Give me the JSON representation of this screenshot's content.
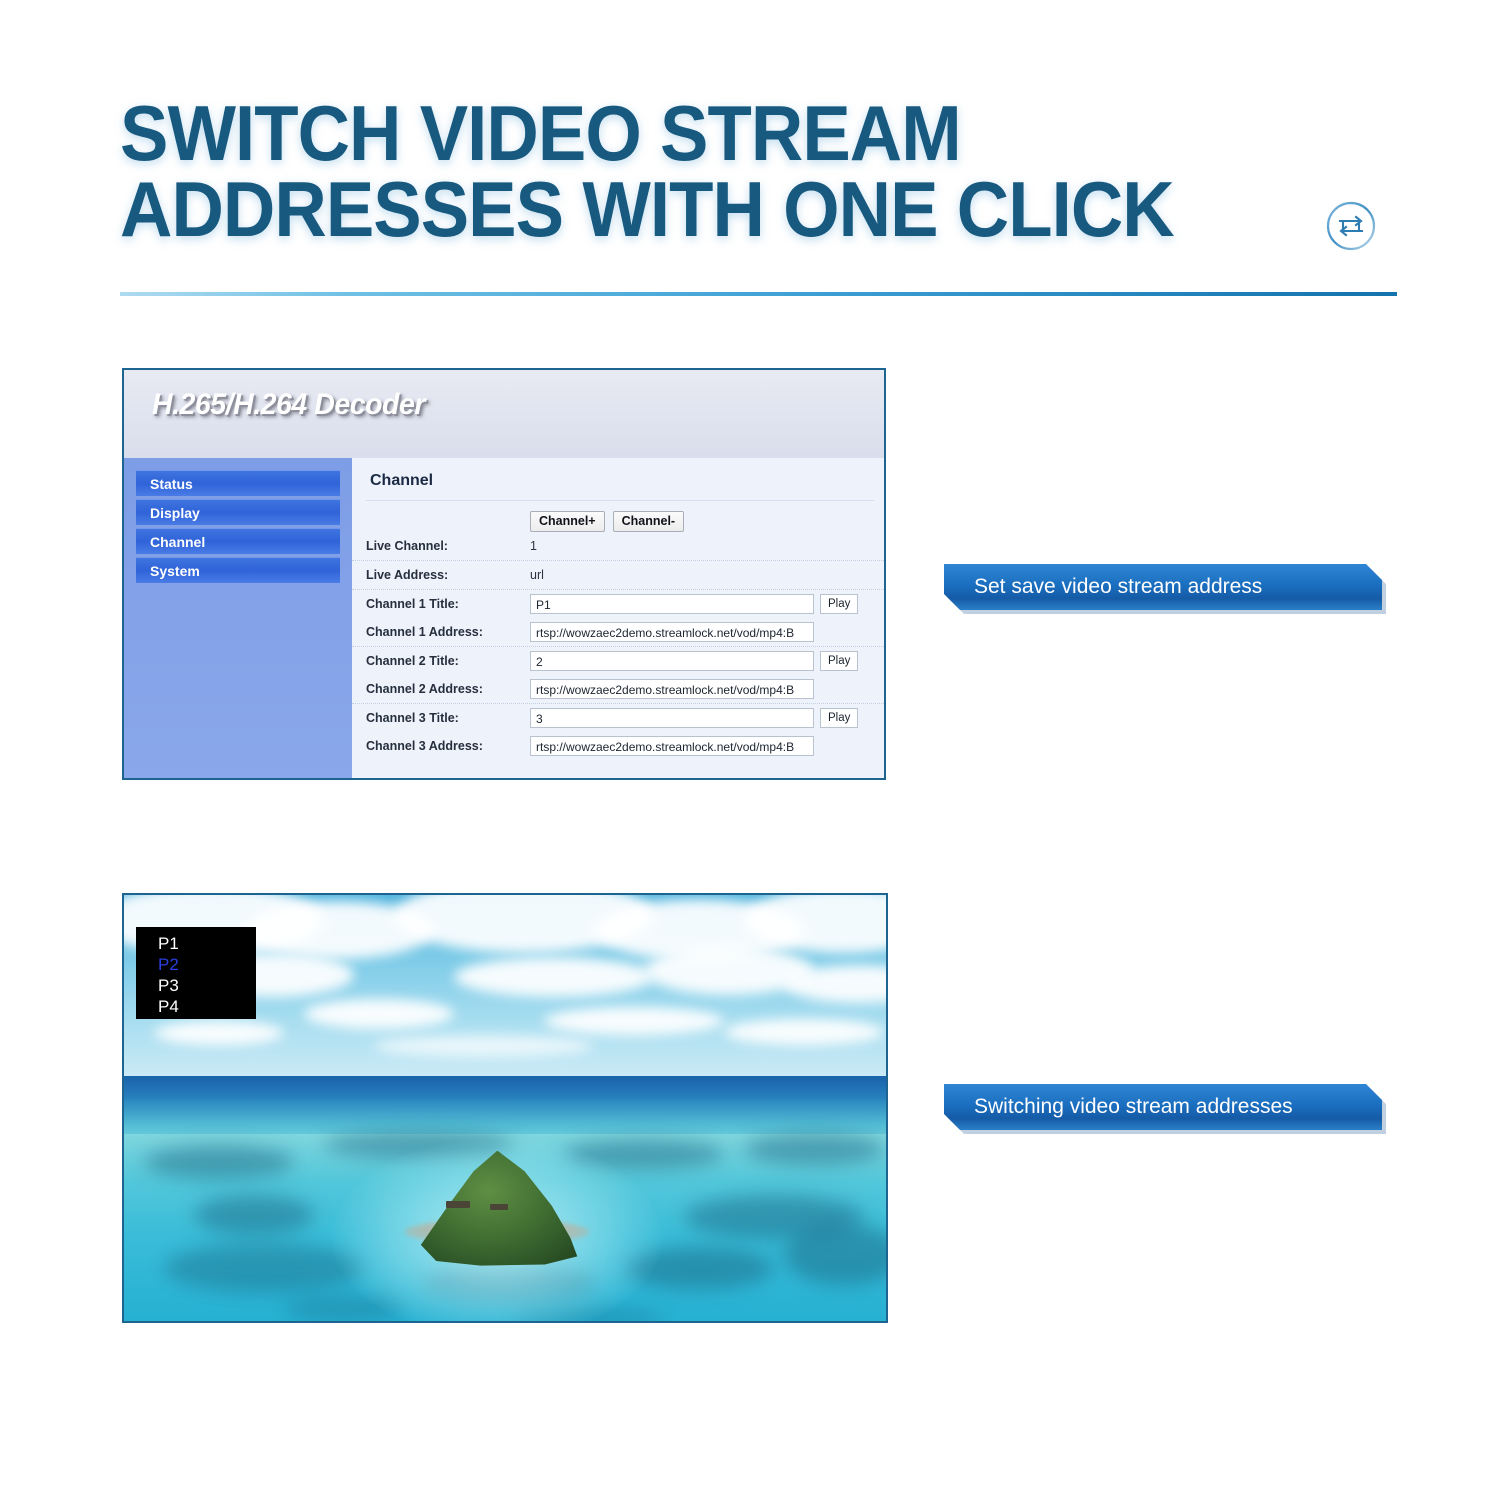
{
  "header": {
    "title": "SWITCH VIDEO STREAM\nADDRESSES WITH ONE CLICK",
    "icon": "switch-repeat-icon",
    "title_color": "#17597f",
    "divider_color_start": "#aedbf0",
    "divider_color_end": "#1273ad"
  },
  "decoder": {
    "brand": "H.265/H.264 Decoder",
    "sidebar": {
      "items": [
        {
          "label": "Status"
        },
        {
          "label": "Display"
        },
        {
          "label": "Channel"
        },
        {
          "label": "System"
        }
      ]
    },
    "content": {
      "heading": "Channel",
      "buttons": {
        "channel_plus": "Channel+",
        "channel_minus": "Channel-"
      },
      "live_channel_label": "Live Channel:",
      "live_channel_value": "1",
      "live_address_label": "Live Address:",
      "live_address_value": "url",
      "play_label": "Play",
      "channels": [
        {
          "title_label": "Channel 1 Title:",
          "title_value": "P1",
          "address_label": "Channel 1 Address:",
          "address_value": "rtsp://wowzaec2demo.streamlock.net/vod/mp4:B"
        },
        {
          "title_label": "Channel 2 Title:",
          "title_value": "2",
          "address_label": "Channel 2 Address:",
          "address_value": "rtsp://wowzaec2demo.streamlock.net/vod/mp4:B"
        },
        {
          "title_label": "Channel 3 Title:",
          "title_value": "3",
          "address_label": "Channel 3 Address:",
          "address_value": "rtsp://wowzaec2demo.streamlock.net/vod/mp4:B"
        }
      ]
    }
  },
  "banners": {
    "top": "Set save video stream address",
    "bottom": "Switching video stream addresses",
    "color": "#1b6fc0"
  },
  "video": {
    "osd": {
      "items": [
        {
          "label": "P1",
          "selected": false
        },
        {
          "label": "P2",
          "selected": true
        },
        {
          "label": "P3",
          "selected": false
        },
        {
          "label": "P4",
          "selected": false
        }
      ],
      "highlight_color": "#2b3fe0"
    },
    "scene": "aerial-tropical-island"
  }
}
